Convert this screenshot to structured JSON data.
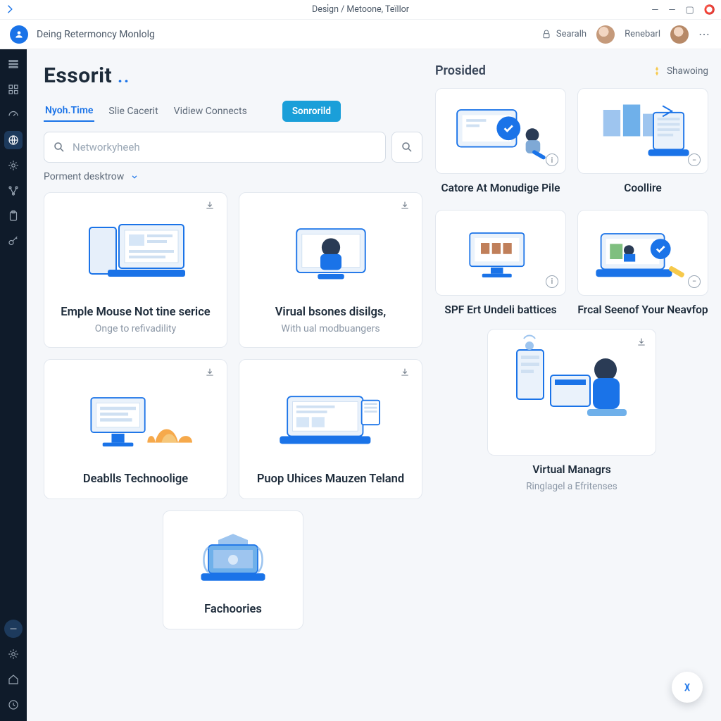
{
  "window": {
    "title": "Desi̇gn / Metoone, Teïllor"
  },
  "header": {
    "brand": "Deing Retermoncy Monlolg",
    "search_label": "Searalh",
    "user_label": "Renebarl"
  },
  "page": {
    "title": "Essorit",
    "tabs": [
      "Nyoh.Time",
      "Slie Cacerit",
      "Vidiew Connects"
    ],
    "pill": "Sonrorild",
    "search_placeholder": "Networkyheeh",
    "filter_label": "Porment desktrow"
  },
  "cards": [
    {
      "title": "Emple Mouse Not tine serice",
      "sub": "Onge to refivadility"
    },
    {
      "title": "Virual bsones disilgs,",
      "sub": "With ual modbuangers"
    },
    {
      "title": "Deablls Technoolige",
      "sub": ""
    },
    {
      "title": "Puop Uhices Mauzen Teland",
      "sub": ""
    },
    {
      "title": "Fachoories",
      "sub": ""
    }
  ],
  "right": {
    "heading": "Prosided",
    "share_label": "Shawoing",
    "items": [
      {
        "title": "Catore At Monudige Pile"
      },
      {
        "title": "Coollire"
      },
      {
        "title": "SPF Ert Undeli battices"
      },
      {
        "title": "Frcal Seenof Your Neavfop"
      },
      {
        "title": "Virtual Managrs",
        "sub": "Ringlagel a Efritenses"
      }
    ]
  },
  "rail": {
    "items": [
      "menu",
      "grid",
      "dashboard",
      "globe",
      "gear",
      "nodes",
      "clipboard",
      "key"
    ],
    "bottom": [
      "minus",
      "settings",
      "home",
      "clock"
    ]
  }
}
